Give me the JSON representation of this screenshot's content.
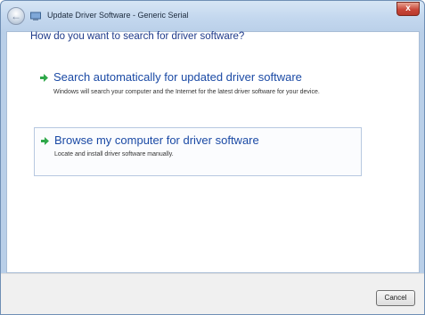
{
  "window": {
    "title": "Update Driver Software - Generic Serial",
    "close_label": "x"
  },
  "main": {
    "heading": "How do you want to search for driver software?",
    "options": [
      {
        "title": "Search automatically for updated driver software",
        "description": "Windows will search your computer and the Internet for the latest driver software for your device."
      },
      {
        "title": "Browse my computer for driver software",
        "description": "Locate and install driver software manually."
      }
    ]
  },
  "footer": {
    "cancel_label": "Cancel"
  },
  "icons": {
    "back": "back-arrow-icon",
    "app": "device-manager-icon",
    "option_arrow": "green-arrow-icon",
    "close": "close-icon"
  },
  "colors": {
    "link_blue": "#1b4aa5",
    "heading_blue": "#1e3a8a",
    "arrow_green": "#2fa84a",
    "close_red": "#c9473a"
  }
}
